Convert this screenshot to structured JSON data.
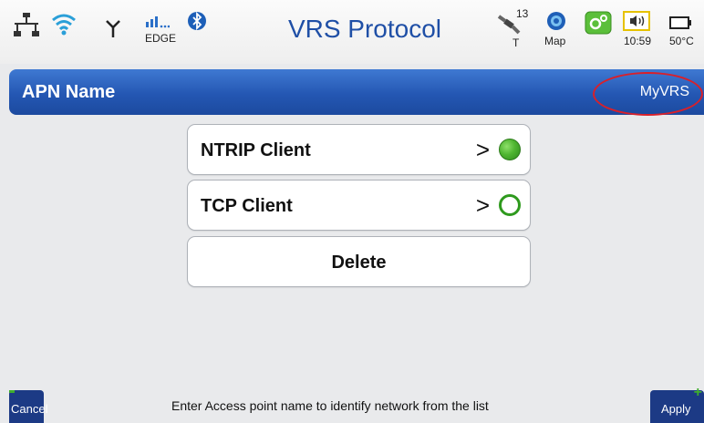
{
  "header": {
    "title": "VRS Protocol",
    "network_type": "EDGE",
    "satellite_count": "13",
    "satellite_label": "T",
    "map_label": "Map",
    "time": "10:59",
    "temperature": "50°C"
  },
  "apn": {
    "label": "APN Name",
    "value": "MyVRS"
  },
  "list": [
    {
      "label": "NTRIP Client",
      "chevron": ">",
      "status": "selected"
    },
    {
      "label": "TCP Client",
      "chevron": ">",
      "status": "unselected"
    }
  ],
  "delete_label": "Delete",
  "footer": {
    "cancel_label": "Cancel",
    "apply_label": "Apply",
    "hint": "Enter Access point name to identify network from the list"
  },
  "colors": {
    "title": "#1f4fa6",
    "apn_bar": "#2457b3",
    "highlight_ring": "#d9202a",
    "status_on": "#4fb531",
    "footer_button": "#1c3a85"
  }
}
